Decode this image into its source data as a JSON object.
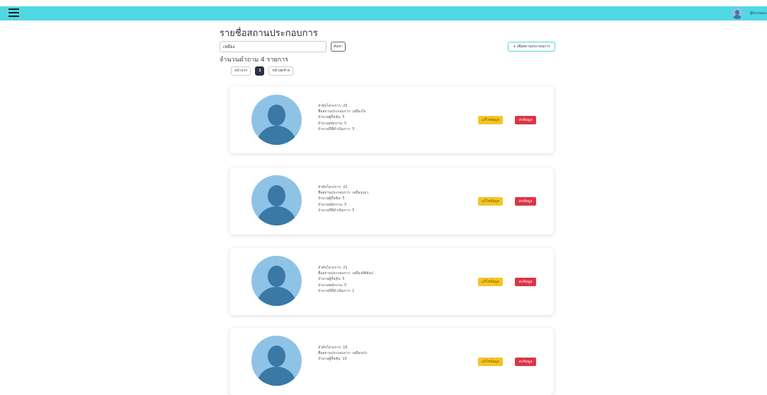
{
  "topbar": {
    "menu_icon": "hamburger-icon",
    "user_name": "ผู้ประกอบการ",
    "user_icon": "user-avatar-icon",
    "color": "#4fd8e4"
  },
  "page": {
    "title": "รายชื่อสถานประกอบการ",
    "search_value": "เหมือง",
    "search_button": "ค้นหา",
    "add_button": "+ เพิ่มสถานประกอบการ",
    "result_count": "จำนวนคำถาม 4 รายการ"
  },
  "pagination": {
    "first": "หน้าแรก",
    "current": "1",
    "last": "หน้าสุดท้าย"
  },
  "cards": [
    {
      "id_line": "ลำดับโครงการ: 25",
      "name_line": "ชื่อสถานประกอบการ: เหมืองใจ",
      "shareholders_line": "จำนวนผู้ถือหุ้น: 5",
      "employees_line": "จำนวนพนักงาน: 5",
      "years_line": "จำนวนปีที่ดำเนินการ: 5",
      "edit_label": "แก้ไขข้อมูล",
      "delete_label": "ลบข้อมูล"
    },
    {
      "id_line": "ลำดับโครงการ: 22",
      "name_line": "ชื่อสถานประกอบการ: เหมืองแมว",
      "shareholders_line": "จำนวนผู้ถือหุ้น: 5",
      "employees_line": "จำนวนพนักงาน: 5",
      "years_line": "จำนวนปีที่ดำเนินการ: 5",
      "edit_label": "แก้ไขข้อมูล",
      "delete_label": "ลบข้อมูล"
    },
    {
      "id_line": "ลำดับโครงการ: 21",
      "name_line": "ชื่อสถานประกอบการ: เหมืองอิซิฮ์อป",
      "shareholders_line": "จำนวนผู้ถือหุ้น: 5",
      "employees_line": "จำนวนพนักงาน: 5",
      "years_line": "จำนวนปีที่ดำเนินการ: 1",
      "edit_label": "แก้ไขข้อมูล",
      "delete_label": "ลบข้อมูล"
    },
    {
      "id_line": "ลำดับโครงการ: 16",
      "name_line": "ชื่อสถานประกอบการ: เหมืองเป่า",
      "shareholders_line": "จำนวนผู้ถือหุ้น: 10",
      "employees_line": "",
      "years_line": "",
      "edit_label": "แก้ไขข้อมูล",
      "delete_label": "ลบข้อมูล"
    }
  ]
}
